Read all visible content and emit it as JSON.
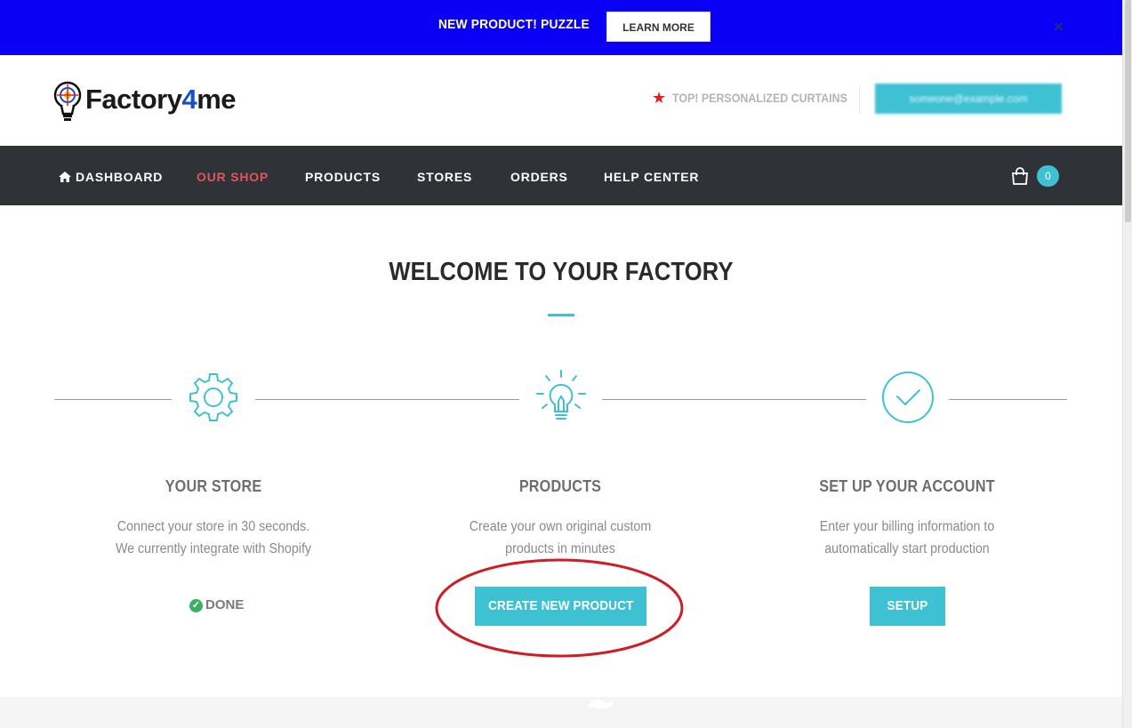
{
  "announcement": {
    "text": "NEW PRODUCT!  PUZZLE",
    "button_label": "LEARN MORE",
    "close_glyph": "×"
  },
  "header": {
    "logo_prefix": "Factory",
    "logo_four": "4",
    "logo_suffix": "me",
    "top_link": "TOP! PERSONALIZED CURTAINS",
    "account_label": "someone@example.com"
  },
  "nav": {
    "items": [
      {
        "label": "DASHBOARD",
        "icon": "home-icon"
      },
      {
        "label": "OUR SHOP",
        "active": true
      },
      {
        "label": "PRODUCTS"
      },
      {
        "label": "STORES"
      },
      {
        "label": "ORDERS"
      },
      {
        "label": "HELP CENTER"
      }
    ],
    "cart_count": "0"
  },
  "main": {
    "title": "WELCOME TO YOUR FACTORY",
    "steps": [
      {
        "icon": "gear-icon",
        "title": "YOUR STORE",
        "desc_line1": "Connect your store in 30 seconds.",
        "desc_line2": "We currently integrate with Shopify",
        "status": "DONE"
      },
      {
        "icon": "lightbulb-icon",
        "title": "PRODUCTS",
        "desc_line1": "Create your own original custom",
        "desc_line2": "products in minutes",
        "button_label": "CREATE NEW PRODUCT"
      },
      {
        "icon": "checkmark-circle-icon",
        "title": "SET UP YOUR ACCOUNT",
        "desc_line1": "Enter your billing information to",
        "desc_line2": "automatically start production",
        "button_label": "SETUP"
      }
    ]
  },
  "colors": {
    "announcement_bg": "#0a00f5",
    "announcement_text": "#ffff99",
    "accent": "#3ec1d3",
    "nav_bg": "#2f3237",
    "nav_active": "#e0555a",
    "annotation_red": "#d01c24",
    "done_green": "#3dae64"
  }
}
